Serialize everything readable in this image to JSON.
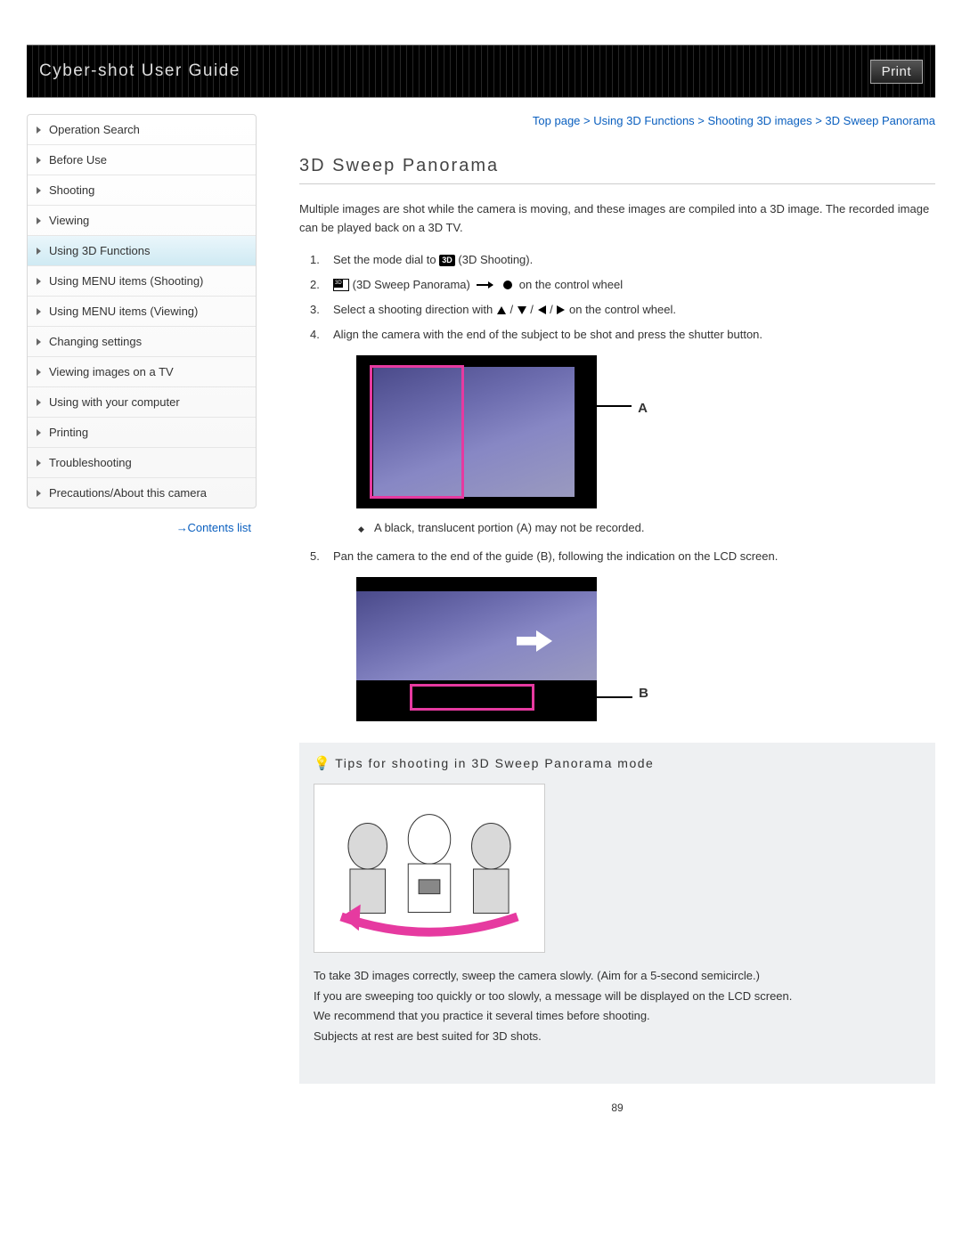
{
  "header": {
    "title": "Cyber-shot User Guide",
    "print_label": "Print"
  },
  "sidebar": {
    "items": [
      {
        "label": "Operation Search",
        "active": false
      },
      {
        "label": "Before Use",
        "active": false
      },
      {
        "label": "Shooting",
        "active": false
      },
      {
        "label": "Viewing",
        "active": false
      },
      {
        "label": "Using 3D Functions",
        "active": true
      },
      {
        "label": "Using MENU items (Shooting)",
        "active": false
      },
      {
        "label": "Using MENU items (Viewing)",
        "active": false
      },
      {
        "label": "Changing settings",
        "active": false
      },
      {
        "label": "Viewing images on a TV",
        "active": false
      },
      {
        "label": "Using with your computer",
        "active": false
      },
      {
        "label": "Printing",
        "active": false
      },
      {
        "label": "Troubleshooting",
        "active": false
      },
      {
        "label": "Precautions/About this camera",
        "active": false
      }
    ],
    "contents_link": "Contents list"
  },
  "breadcrumb": {
    "items": [
      "Top page",
      "Using 3D Functions",
      "Shooting 3D images",
      "3D Sweep Panorama"
    ]
  },
  "page_title": "3D Sweep Panorama",
  "intro": "Multiple images are shot while the camera is moving, and these images are compiled into a 3D image. The recorded image can be played back on a 3D TV.",
  "steps": {
    "s1_a": "Set the mode dial to",
    "s1_b": "(3D Shooting).",
    "s1_icon": "3D",
    "s2_a": "(3D Sweep Panorama)",
    "s2_b": "on the control wheel",
    "s3_a": "Select a shooting direction with",
    "s3_b": "on the control wheel.",
    "s4": "Align the camera with the end of the subject to be shot and press the shutter button.",
    "s4_note": "A black, translucent portion (A) may not be recorded.",
    "s5": "Pan the camera to the end of the guide (B), following the indication on the LCD screen.",
    "label_a": "A",
    "label_b": "B"
  },
  "tips": {
    "title": "Tips for shooting in 3D Sweep Panorama mode",
    "p1": "To take 3D images correctly, sweep the camera slowly. (Aim for a 5-second semicircle.)",
    "p2": "If you are sweeping too quickly or too slowly, a message will be displayed on the LCD screen.",
    "p3": "We recommend that you practice it several times before shooting.",
    "p4": "Subjects at rest are best suited for 3D shots."
  },
  "page_number": "89"
}
